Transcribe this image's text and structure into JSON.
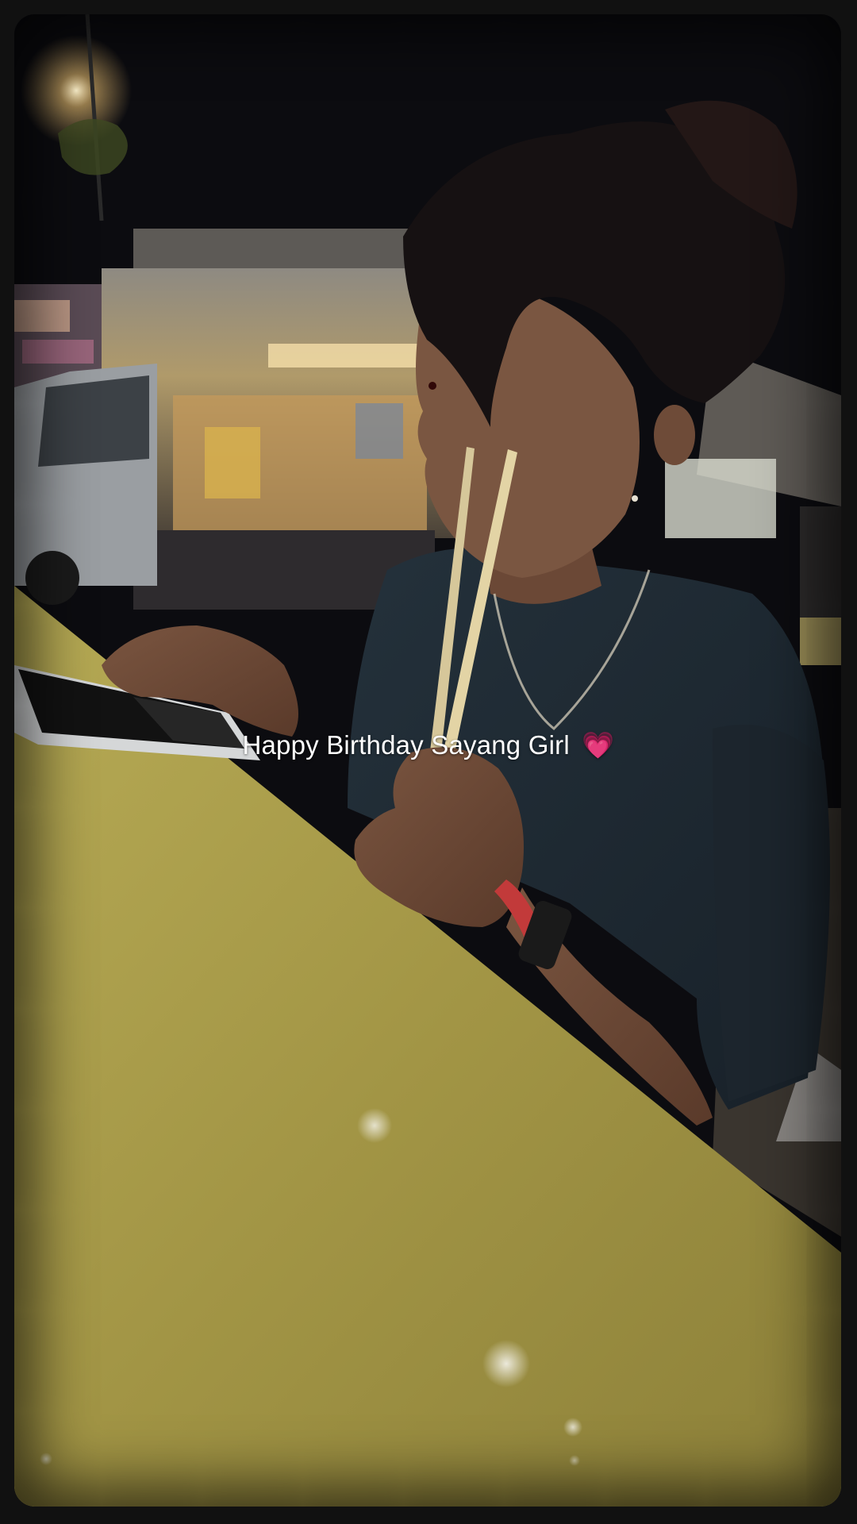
{
  "caption": {
    "text": "Happy Birthday Sayang Girl",
    "emoji": "💗"
  },
  "photo": {
    "subject": "person-with-chopsticks-at-night-food-stall",
    "colors": {
      "table": "#a89b46",
      "shirt": "#1f2a33",
      "hair": "#141010",
      "background": "#0c0c10",
      "stall_light": "#e8c98a"
    }
  }
}
